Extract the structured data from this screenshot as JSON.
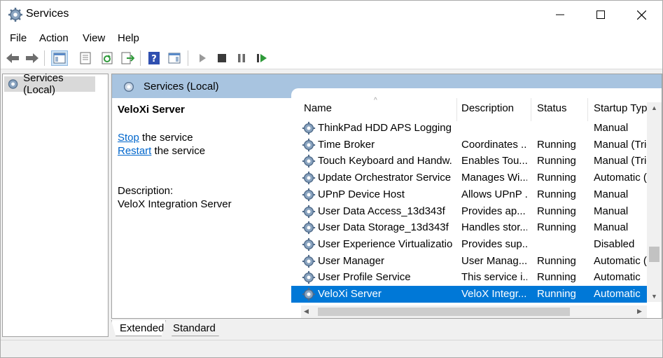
{
  "window": {
    "title": "Services"
  },
  "menu": [
    {
      "label": "File"
    },
    {
      "label": "Action"
    },
    {
      "label": "View"
    },
    {
      "label": "Help"
    }
  ],
  "toolbar": {
    "icons": [
      "back-icon",
      "forward-icon",
      "show-hide-console-tree-icon",
      "properties-icon",
      "refresh-icon",
      "export-list-icon",
      "help-icon",
      "show-hide-action-pane-icon",
      "start-service-icon",
      "stop-service-icon",
      "pause-service-icon",
      "restart-service-icon"
    ]
  },
  "tree": {
    "root_label": "Services (Local)"
  },
  "main": {
    "header_title": "Services (Local)",
    "selected_service": "VeloXi Server",
    "stop_link": "Stop",
    "stop_suffix": " the service",
    "restart_link": "Restart",
    "restart_suffix": " the service",
    "description_label": "Description:",
    "description_text": "VeloX Integration Server"
  },
  "list": {
    "columns": [
      {
        "label": "Name"
      },
      {
        "label": "Description"
      },
      {
        "label": "Status"
      },
      {
        "label": "Startup Type"
      }
    ],
    "rows": [
      {
        "name": "ThinkPad HDD APS Logging ...",
        "description": "",
        "status": "",
        "startup": "Manual"
      },
      {
        "name": "Time Broker",
        "description": "Coordinates ...",
        "status": "Running",
        "startup": "Manual (Trig"
      },
      {
        "name": "Touch Keyboard and Handw...",
        "description": "Enables Tou...",
        "status": "Running",
        "startup": "Manual (Trig"
      },
      {
        "name": "Update Orchestrator Service",
        "description": "Manages Wi...",
        "status": "Running",
        "startup": "Automatic (I"
      },
      {
        "name": "UPnP Device Host",
        "description": "Allows UPnP ...",
        "status": "Running",
        "startup": "Manual"
      },
      {
        "name": "User Data Access_13d343f",
        "description": "Provides ap...",
        "status": "Running",
        "startup": "Manual"
      },
      {
        "name": "User Data Storage_13d343f",
        "description": "Handles stor...",
        "status": "Running",
        "startup": "Manual"
      },
      {
        "name": "User Experience Virtualizatio...",
        "description": "Provides sup...",
        "status": "",
        "startup": "Disabled"
      },
      {
        "name": "User Manager",
        "description": "User Manag...",
        "status": "Running",
        "startup": "Automatic (T"
      },
      {
        "name": "User Profile Service",
        "description": "This service i...",
        "status": "Running",
        "startup": "Automatic"
      },
      {
        "name": "VeloXi Server",
        "description": "VeloX Integr...",
        "status": "Running",
        "startup": "Automatic",
        "selected": true
      }
    ]
  },
  "tabs": [
    {
      "label": "Extended"
    },
    {
      "label": "Standard"
    }
  ],
  "colors": {
    "selection": "#0078d7",
    "header": "#a8c4e0",
    "link": "#0066cc"
  }
}
